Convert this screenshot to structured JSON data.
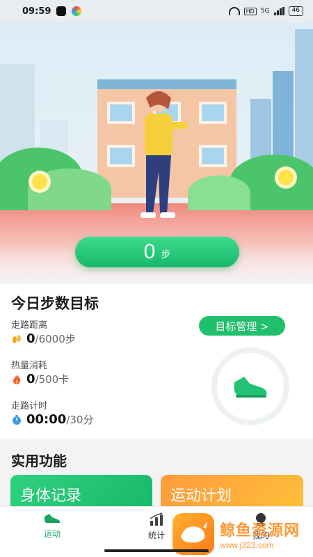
{
  "status_bar": {
    "time": "09:59",
    "hd_label": "HD",
    "battery": "46",
    "net": "5G"
  },
  "hero": {
    "steps_value": "0",
    "steps_unit": "步"
  },
  "goal": {
    "title": "今日步数目标",
    "manage_button": "目标管理 >",
    "metrics": [
      {
        "label": "走路距离",
        "current": "0",
        "total": "/6000步",
        "icon": "footprints-icon"
      },
      {
        "label": "热量消耗",
        "current": "0",
        "total": "/500卡",
        "icon": "flame-icon"
      },
      {
        "label": "走路计时",
        "current": "00:00",
        "total": "/30分",
        "icon": "stopwatch-icon"
      }
    ]
  },
  "utilities": {
    "title": "实用功能",
    "cards": [
      {
        "label": "身体记录",
        "color": "#1fbf6c"
      },
      {
        "label": "运动计划",
        "color": "#ff9f3a"
      }
    ]
  },
  "nav": {
    "items": [
      {
        "label": "运动",
        "icon": "sneaker-icon",
        "active": true
      },
      {
        "label": "统计",
        "icon": "bar-chart-icon",
        "active": false
      },
      {
        "label": "我的",
        "icon": "user-icon",
        "active": false
      }
    ]
  },
  "watermark": {
    "name": "鲸鱼资源网",
    "url": "www.j323.com"
  },
  "colors": {
    "accent_green": "#1fbf6c",
    "accent_orange": "#ff9f3a"
  }
}
